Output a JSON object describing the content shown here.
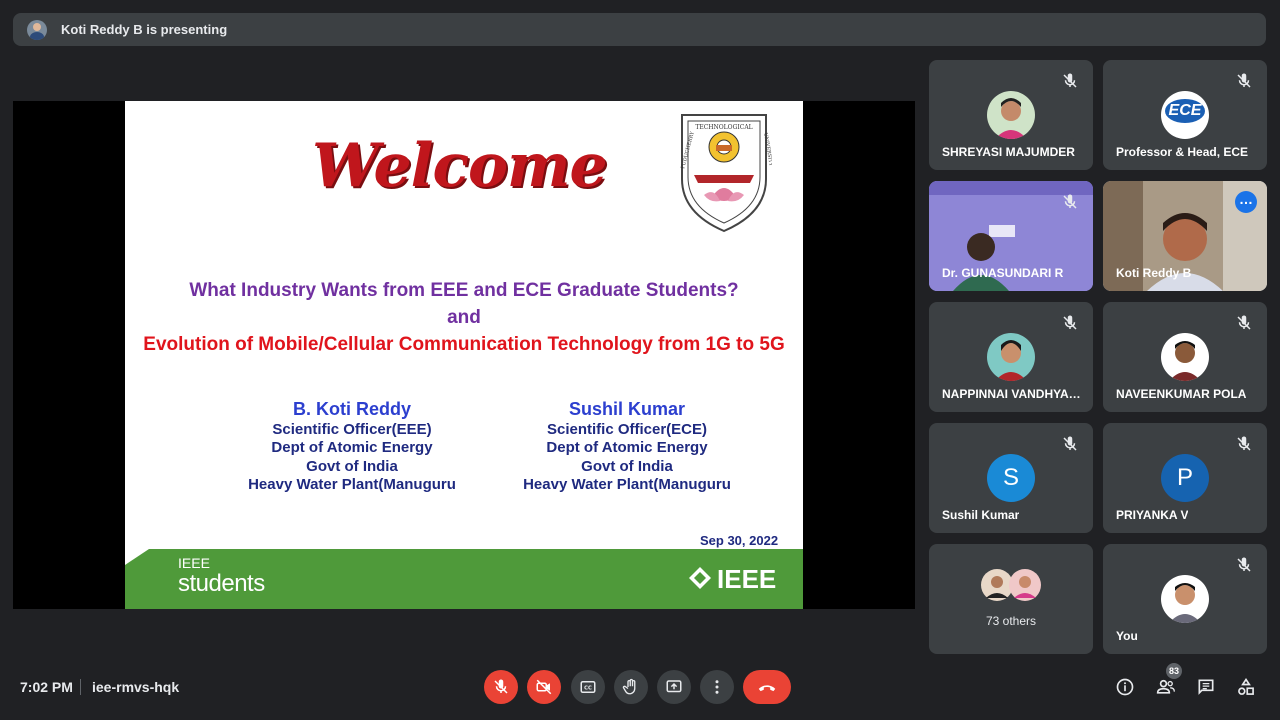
{
  "presenting_banner": "Koti Reddy B is presenting",
  "slide": {
    "welcome": "Welcome",
    "seal_text_top": "TECHNOLOGICAL",
    "seal_text_left": "PUDUCHERRY",
    "seal_text_right": "UNIVERSITY",
    "title_line1": "What Industry Wants from EEE and ECE Graduate Students?",
    "title_and": "and",
    "title_line2": "Evolution of Mobile/Cellular Communication Technology from 1G to 5G",
    "author1": {
      "name": "B. Koti Reddy",
      "role": "Scientific Officer(EEE)",
      "dept": "Dept of Atomic  Energy",
      "govt": "Govt of India",
      "plant": "Heavy Water Plant(Manuguru"
    },
    "author2": {
      "name": "Sushil Kumar",
      "role": "Scientific Officer(ECE)",
      "dept": "Dept of Atomic  Energy",
      "govt": "Govt of India",
      "plant": "Heavy Water Plant(Manuguru"
    },
    "date": "Sep 30, 2022",
    "footer_ieee_small": "IEEE",
    "footer_students": "students",
    "footer_ieee_logo": "IEEE"
  },
  "participants": [
    {
      "name": "SHREYASI MAJUMDER",
      "muted": true
    },
    {
      "name": "Professor & Head, ECE",
      "muted": true,
      "logo_text": "ECE"
    },
    {
      "name": "Dr. GUNASUNDARI R",
      "muted": true,
      "video": true
    },
    {
      "name": "Koti Reddy B",
      "muted": false,
      "video": true,
      "active": true
    },
    {
      "name": "NAPPINNAI VANDHYA…",
      "muted": true
    },
    {
      "name": "NAVEENKUMAR POLA",
      "muted": true
    },
    {
      "name": "Sushil Kumar",
      "muted": true,
      "initial": "S",
      "color": "#1a8ad6"
    },
    {
      "name": "PRIYANKA V",
      "muted": true,
      "initial": "P",
      "color": "#1663b0"
    },
    {
      "name": "73 others",
      "group": true
    },
    {
      "name": "You",
      "muted": true
    }
  ],
  "bottom_bar": {
    "time": "7:02 PM",
    "meeting_code": "iee-rmvs-hqk",
    "people_count": "83",
    "controls": [
      "mic-off",
      "camera-off",
      "captions",
      "raise-hand",
      "present",
      "more-options",
      "leave-call"
    ],
    "right_icons": [
      "info",
      "people",
      "chat",
      "activities"
    ]
  },
  "colors": {
    "background": "#202124",
    "tile": "#3c4043",
    "danger": "#ea4335",
    "accent": "#8ab4f8"
  }
}
